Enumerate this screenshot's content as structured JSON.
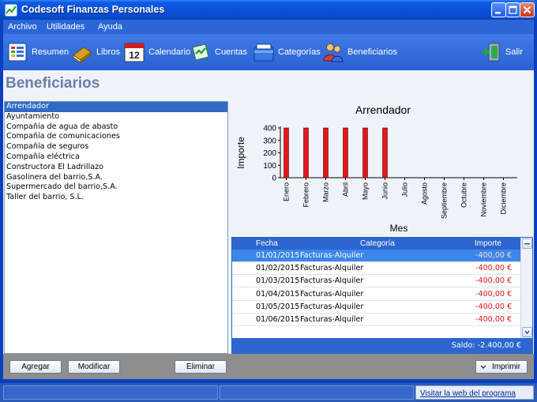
{
  "window": {
    "title": "Codesoft Finanzas Personales",
    "controls": [
      "minimize",
      "maximize",
      "close"
    ]
  },
  "menu": [
    {
      "label": "Archivo"
    },
    {
      "label": "Utilidades"
    },
    {
      "label": "Ayuda"
    }
  ],
  "toolbar": [
    {
      "label": "Resumen",
      "icon": "summary-icon"
    },
    {
      "label": "Libros",
      "icon": "books-icon"
    },
    {
      "label": "Calendario",
      "icon": "calendar-icon",
      "badge": "12"
    },
    {
      "label": "Cuentas",
      "icon": "accounts-icon"
    },
    {
      "label": "Categorías",
      "icon": "categories-icon"
    },
    {
      "label": "Beneficiarios",
      "icon": "beneficiaries-icon"
    },
    {
      "label": "Salir",
      "icon": "exit-icon"
    }
  ],
  "page": {
    "title": "Beneficiarios"
  },
  "payees": [
    "Arrendador",
    "Ayuntamiento",
    "Compañía de agua de abasto",
    "Compañía de comunicaciones",
    "Compañía de seguros",
    "Compañía eléctrica",
    "Constructora El Ladrillazo",
    "Gasolinera del barrio,S.A.",
    "Supermercado del barrio,S.A.",
    "Taller del barrio, S.L."
  ],
  "selected_payee_index": 0,
  "chart_data": {
    "type": "bar",
    "title": "Arrendador",
    "xlabel": "Mes",
    "ylabel": "Importe",
    "categories": [
      "Enero",
      "Febrero",
      "Marzo",
      "Abril",
      "Mayo",
      "Junio",
      "Julio",
      "Agosto",
      "Septiembre",
      "Octubre",
      "Noviembre",
      "Diciembre"
    ],
    "values": [
      400,
      400,
      400,
      400,
      400,
      400,
      0,
      0,
      0,
      0,
      0,
      0
    ],
    "ylim": [
      0,
      400
    ],
    "yticks": [
      "0",
      "100",
      "200",
      "300",
      "400"
    ],
    "bar_color": "#e0181c",
    "grid": false,
    "legend": "none"
  },
  "table": {
    "headers": {
      "date": "Fecha",
      "category": "Categoría",
      "amount": "Importe"
    },
    "rows": [
      {
        "date": "01/01/2015",
        "category": "Facturas-Alquiler",
        "amount": "-400,00 €"
      },
      {
        "date": "01/02/2015",
        "category": "Facturas-Alquiler",
        "amount": "-400,00 €"
      },
      {
        "date": "01/03/2015",
        "category": "Facturas-Alquiler",
        "amount": "-400,00 €"
      },
      {
        "date": "01/04/2015",
        "category": "Facturas-Alquiler",
        "amount": "-400,00 €"
      },
      {
        "date": "01/05/2015",
        "category": "Facturas-Alquiler",
        "amount": "-400,00 €"
      },
      {
        "date": "01/06/2015",
        "category": "Facturas-Alquiler",
        "amount": "-400,00 €"
      }
    ],
    "selected_row_index": 0,
    "balance": "Saldo: -2.400,00 €"
  },
  "buttons": {
    "add": "Agregar",
    "modify": "Modificar",
    "delete": "Eliminar",
    "print": "Imprimir"
  },
  "status": {
    "link": "Visitar la web del programa"
  },
  "colors": {
    "accent": "#316ac5",
    "titlebar": "#0a52d8",
    "negative": "#e01818"
  }
}
